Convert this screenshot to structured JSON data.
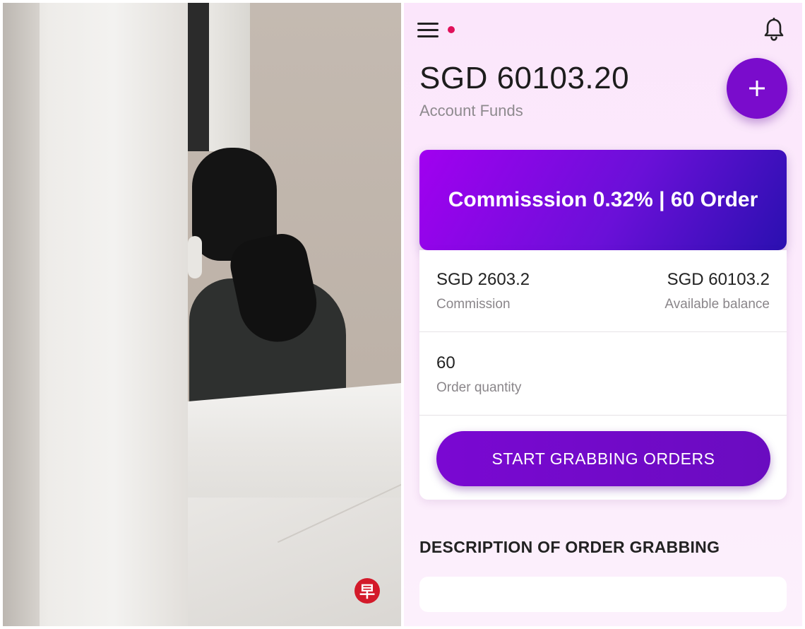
{
  "app": {
    "balance": "SGD 60103.20",
    "balance_label": "Account Funds",
    "banner_text": "Commisssion 0.32% | 60 Order",
    "commission_value": "SGD 2603.2",
    "commission_label": "Commission",
    "available_value": "SGD 60103.2",
    "available_label": "Available balance",
    "order_quantity_value": "60",
    "order_quantity_label": "Order quantity",
    "start_button_label": "START GRABBING ORDERS",
    "section_title": "DESCRIPTION OF ORDER GRABBING",
    "logo_text": "早"
  },
  "icons": {
    "menu": "hamburger-icon",
    "notification_dot": "notification-dot",
    "bell": "bell-icon",
    "add": "plus-icon"
  },
  "colors": {
    "accent": "#7a0ccc",
    "banner_start": "#a100f0",
    "banner_end": "#2a10b0",
    "notification": "#e0105a",
    "logo": "#d31a2a"
  }
}
